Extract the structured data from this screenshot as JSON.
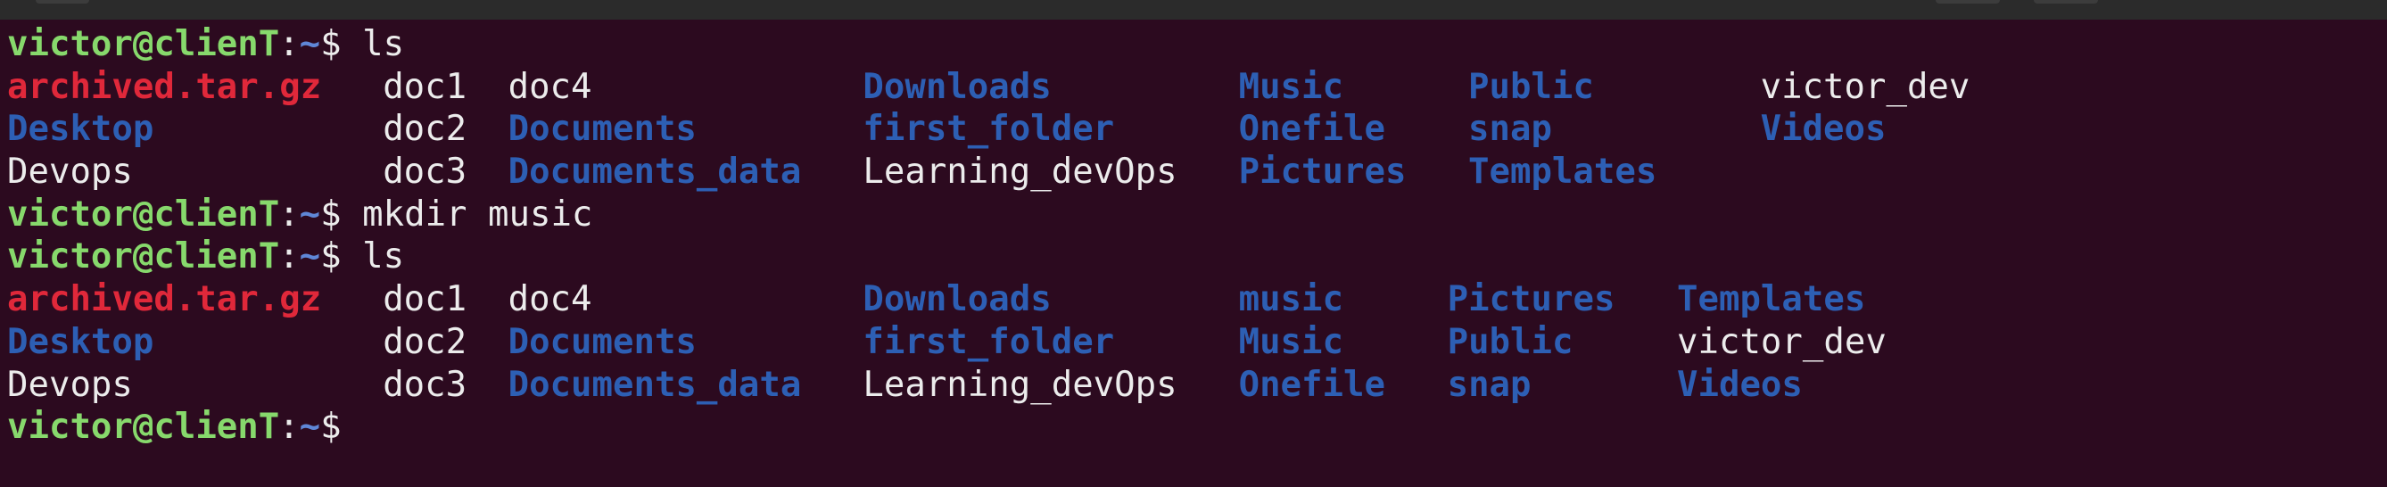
{
  "prompt": {
    "user": "victor@clienT",
    "sep": ":",
    "path": "~",
    "symbol": "$ "
  },
  "colors": {
    "background": "#2c0a1f",
    "prompt_user": "#87d96c",
    "prompt_path": "#5f87d7",
    "archive": "#e0283a",
    "directory": "#2d5fb4",
    "file": "#ececec"
  },
  "lines": [
    {
      "type": "prompt",
      "command": "ls"
    },
    {
      "type": "listing",
      "entries": [
        {
          "text": "archived.tar.gz",
          "kind": "archive"
        },
        {
          "text": "doc1",
          "kind": "file"
        },
        {
          "text": "doc4",
          "kind": "file"
        },
        {
          "text": "Downloads",
          "kind": "dir"
        },
        {
          "text": "Music",
          "kind": "dir"
        },
        {
          "text": "Public",
          "kind": "dir"
        },
        {
          "text": "victor_dev",
          "kind": "file"
        }
      ]
    },
    {
      "type": "listing",
      "entries": [
        {
          "text": "Desktop",
          "kind": "dir"
        },
        {
          "text": "doc2",
          "kind": "file"
        },
        {
          "text": "Documents",
          "kind": "dir"
        },
        {
          "text": "first_folder",
          "kind": "dir"
        },
        {
          "text": "Onefile",
          "kind": "dir"
        },
        {
          "text": "snap",
          "kind": "dir"
        },
        {
          "text": "Videos",
          "kind": "dir"
        }
      ]
    },
    {
      "type": "listing",
      "entries": [
        {
          "text": "Devops",
          "kind": "file"
        },
        {
          "text": "doc3",
          "kind": "file"
        },
        {
          "text": "Documents_data",
          "kind": "dir"
        },
        {
          "text": "Learning_devOps",
          "kind": "file"
        },
        {
          "text": "Pictures",
          "kind": "dir"
        },
        {
          "text": "Templates",
          "kind": "dir"
        }
      ]
    },
    {
      "type": "prompt",
      "command": "mkdir music"
    },
    {
      "type": "prompt",
      "command": "ls"
    },
    {
      "type": "listing",
      "entries": [
        {
          "text": "archived.tar.gz",
          "kind": "archive"
        },
        {
          "text": "doc1",
          "kind": "file"
        },
        {
          "text": "doc4",
          "kind": "file"
        },
        {
          "text": "Downloads",
          "kind": "dir"
        },
        {
          "text": "music",
          "kind": "dir"
        },
        {
          "text": "Pictures",
          "kind": "dir"
        },
        {
          "text": "Templates",
          "kind": "dir"
        }
      ]
    },
    {
      "type": "listing",
      "entries": [
        {
          "text": "Desktop",
          "kind": "dir"
        },
        {
          "text": "doc2",
          "kind": "file"
        },
        {
          "text": "Documents",
          "kind": "dir"
        },
        {
          "text": "first_folder",
          "kind": "dir"
        },
        {
          "text": "Music",
          "kind": "dir"
        },
        {
          "text": "Public",
          "kind": "dir"
        },
        {
          "text": "victor_dev",
          "kind": "file"
        }
      ]
    },
    {
      "type": "listing",
      "entries": [
        {
          "text": "Devops",
          "kind": "file"
        },
        {
          "text": "doc3",
          "kind": "file"
        },
        {
          "text": "Documents_data",
          "kind": "dir"
        },
        {
          "text": "Learning_devOps",
          "kind": "file"
        },
        {
          "text": "Onefile",
          "kind": "dir"
        },
        {
          "text": "snap",
          "kind": "dir"
        },
        {
          "text": "Videos",
          "kind": "dir"
        }
      ]
    },
    {
      "type": "prompt",
      "command": ""
    }
  ]
}
